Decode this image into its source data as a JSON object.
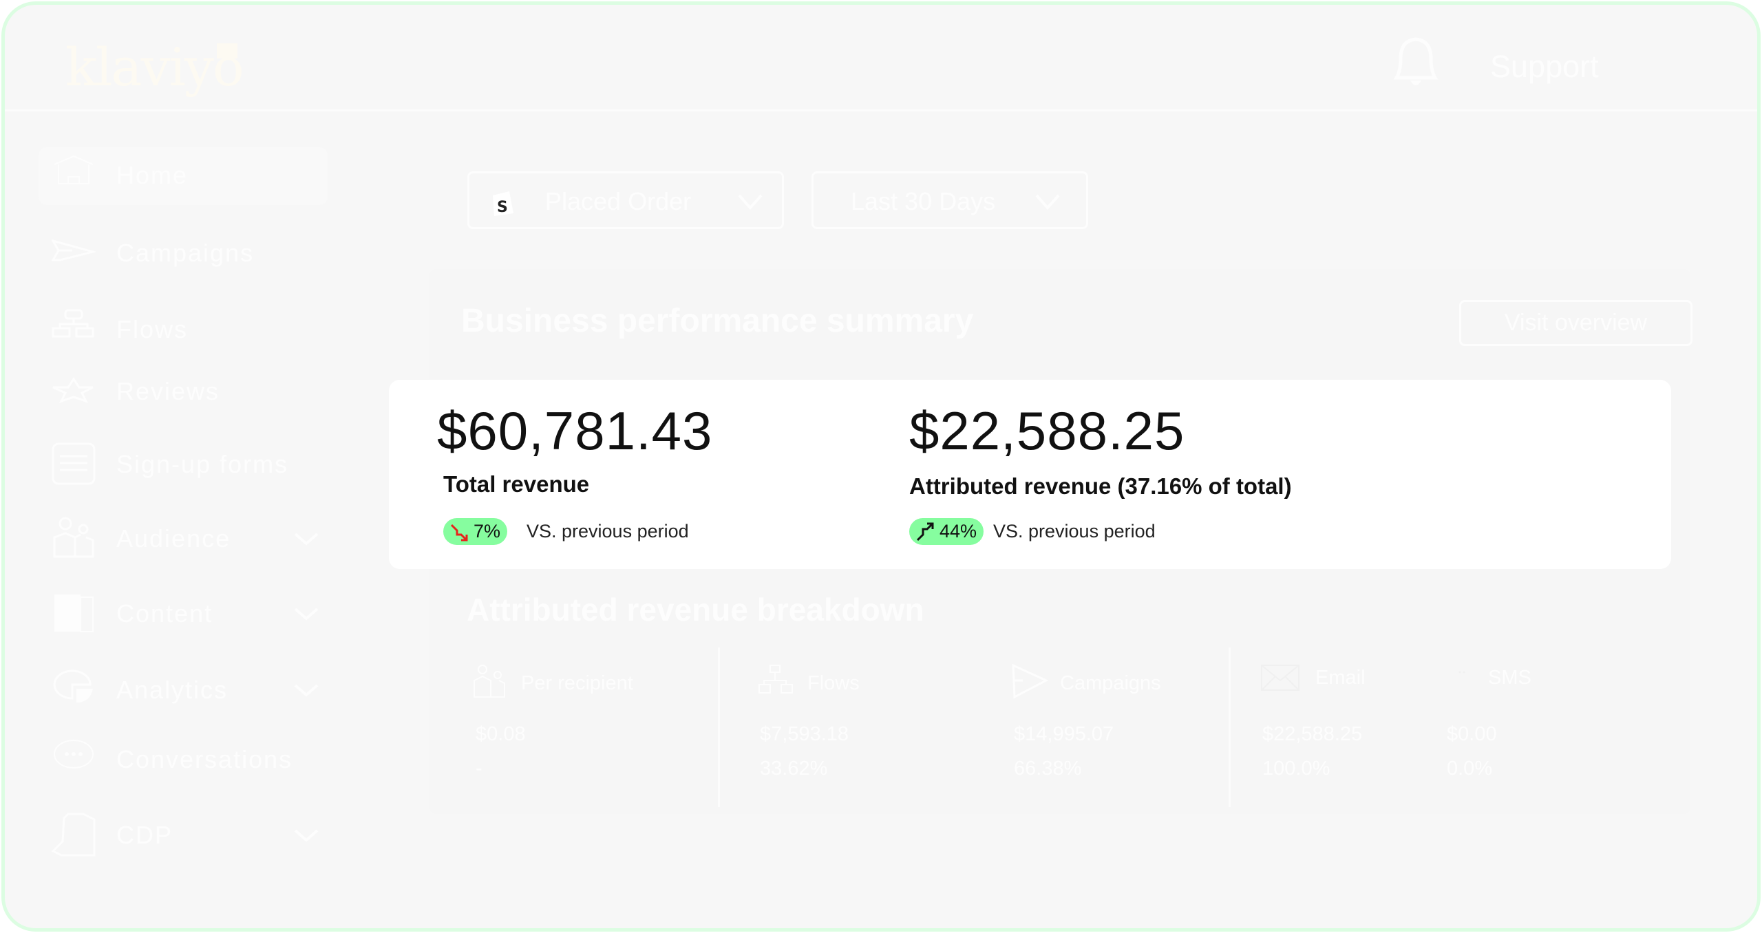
{
  "header": {
    "logo": "klaviyo",
    "support_label": "Support"
  },
  "sidebar": {
    "items": [
      {
        "label": "Home",
        "icon": "home-icon"
      },
      {
        "label": "Campaigns",
        "icon": "send-icon"
      },
      {
        "label": "Flows",
        "icon": "flows-icon"
      },
      {
        "label": "Reviews",
        "icon": "star-icon"
      },
      {
        "label": "Sign-up forms",
        "icon": "form-icon"
      },
      {
        "label": "Audience",
        "icon": "users-icon"
      },
      {
        "label": "Content",
        "icon": "content-icon"
      },
      {
        "label": "Analytics",
        "icon": "chart-icon"
      },
      {
        "label": "Conversations",
        "icon": "chat-icon"
      },
      {
        "label": "CDP",
        "icon": "cdp-icon"
      }
    ]
  },
  "filters": {
    "metric": "Placed Order",
    "period": "Last 30 Days"
  },
  "summary": {
    "title": "Business performance summary",
    "visit_label": "Visit overview",
    "total": {
      "value": "$60,781.43",
      "label": "Total revenue",
      "change": "7%",
      "direction": "down",
      "vs": "VS. previous period"
    },
    "attributed": {
      "value": "$22,588.25",
      "label": "Attributed revenue (37.16% of total)",
      "change": "44%",
      "direction": "up",
      "vs": "VS. previous period"
    }
  },
  "breakdown": {
    "title": "Attributed revenue breakdown",
    "columns": [
      {
        "label": "Per recipient",
        "value": "$0.08",
        "pct": "-"
      },
      {
        "label": "Flows",
        "value": "$7,593.18",
        "pct": "33.62%"
      },
      {
        "label": "Campaigns",
        "value": "$14,995.07",
        "pct": "66.38%"
      },
      {
        "label": "Email",
        "value": "$22,588.25",
        "pct": "100.0%"
      },
      {
        "label": "SMS",
        "value": "$0.00",
        "pct": "0.0%"
      }
    ]
  },
  "colors": {
    "badge": "#86fd9f",
    "down": "#e8221b",
    "background": "#f7f7f7",
    "frame": "#dcfde2"
  }
}
